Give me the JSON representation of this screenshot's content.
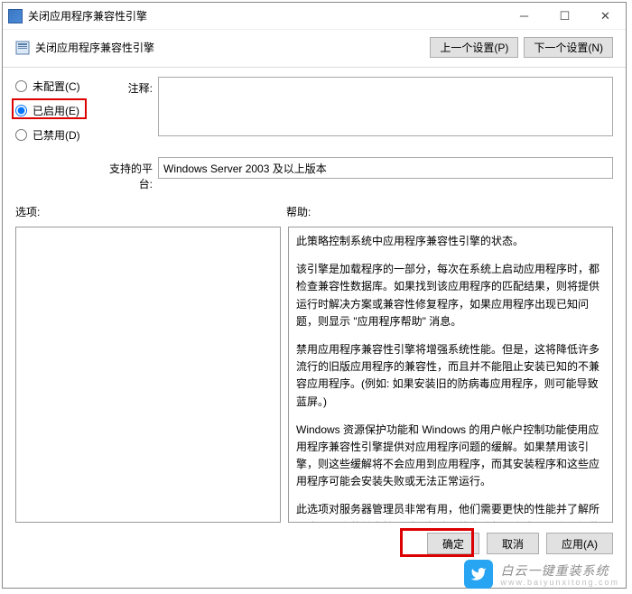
{
  "title": "关闭应用程序兼容性引擎",
  "header": {
    "title": "关闭应用程序兼容性引擎"
  },
  "nav": {
    "prev": "上一个设置(P)",
    "next": "下一个设置(N)"
  },
  "radios": {
    "not_configured": "未配置(C)",
    "enabled": "已启用(E)",
    "disabled": "已禁用(D)",
    "selected": "enabled"
  },
  "labels": {
    "comment": "注释:",
    "platform": "支持的平台:",
    "options": "选项:",
    "help": "帮助:"
  },
  "fields": {
    "comment": "",
    "platform": "Windows Server 2003 及以上版本"
  },
  "help": {
    "p1": "此策略控制系统中应用程序兼容性引擎的状态。",
    "p2": "该引擎是加载程序的一部分，每次在系统上启动应用程序时，都检查兼容性数据库。如果找到该应用程序的匹配结果，则将提供运行时解决方案或兼容性修复程序，如果应用程序出现已知问题，则显示 \"应用程序帮助\" 消息。",
    "p3": "禁用应用程序兼容性引擎将增强系统性能。但是，这将降低许多流行的旧版应用程序的兼容性，而且并不能阻止安装已知的不兼容应用程序。(例如: 如果安装旧的防病毒应用程序，则可能导致蓝屏。)",
    "p4": "Windows 资源保护功能和 Windows 的用户帐户控制功能使用应用程序兼容性引擎提供对应用程序问题的缓解。如果禁用该引擎，则这些缓解将不会应用到应用程序，而其安装程序和这些应用程序可能会安装失败或无法正常运行。",
    "p5": "此选项对服务器管理员非常有用，他们需要更快的性能并了解所用应用程序的兼容性。对于每秒可能启动数百次应用程序且加载程序的性能至关重要的 Web 服务器，该选项尤其有用。"
  },
  "footer": {
    "ok": "确定",
    "cancel": "取消",
    "apply": "应用(A)"
  },
  "watermark": {
    "text": "白云一键重装系统",
    "sub": "www.baiyunxitong.com"
  }
}
